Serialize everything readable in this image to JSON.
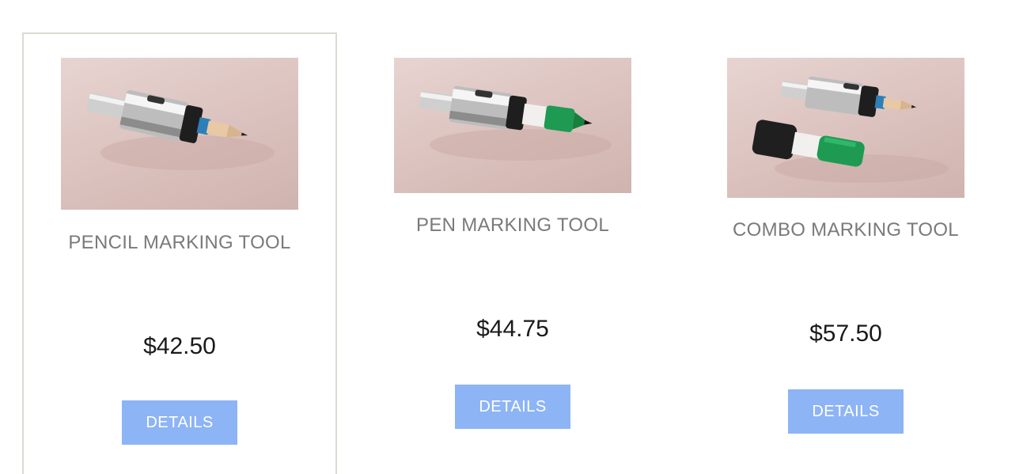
{
  "products": [
    {
      "name": "PENCIL MARKING TOOL",
      "price": "$42.50",
      "details_label": "DETAILS",
      "image_icon": "pencil-marking-tool-photo"
    },
    {
      "name": "PEN MARKING TOOL",
      "price": "$44.75",
      "details_label": "DETAILS",
      "image_icon": "pen-marking-tool-photo"
    },
    {
      "name": "COMBO MARKING TOOL",
      "price": "$57.50",
      "details_label": "DETAILS",
      "image_icon": "combo-marking-tool-photo"
    }
  ],
  "colors": {
    "button_bg": "#8db4f5",
    "button_text": "#ffffff",
    "name_text": "#7a7a7a",
    "price_text": "#1a1a1a",
    "card_border": "#dcdad2",
    "photo_bg": "#dcc3bf"
  }
}
